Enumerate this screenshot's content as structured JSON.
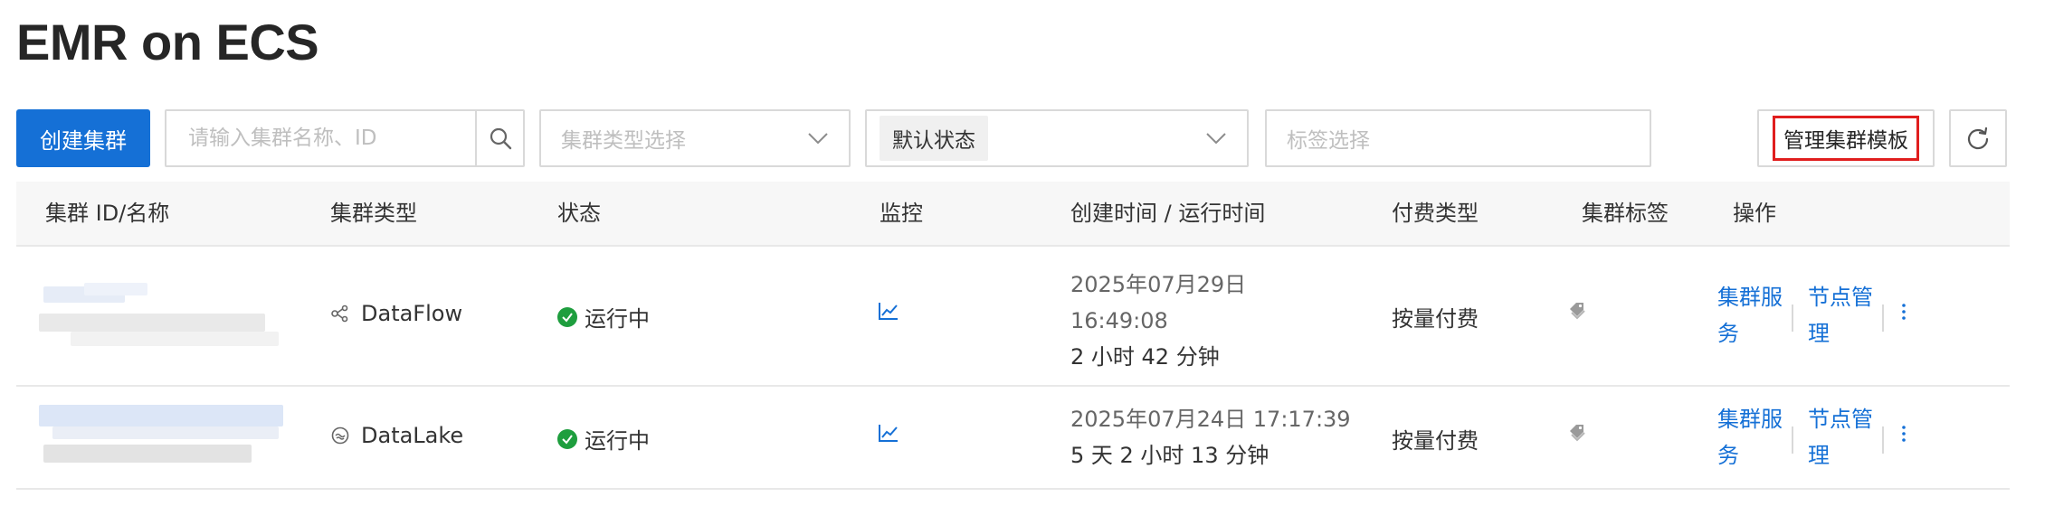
{
  "page": {
    "title": "EMR on ECS"
  },
  "toolbar": {
    "create_label": "创建集群",
    "search_placeholder": "请输入集群名称、ID",
    "type_select_placeholder": "集群类型选择",
    "status_select_value": "默认状态",
    "tag_select_placeholder": "标签选择",
    "manage_template_label": "管理集群模板"
  },
  "table": {
    "columns": [
      "集群 ID/名称",
      "集群类型",
      "状态",
      "监控",
      "创建时间 / 运行时间",
      "付费类型",
      "集群标签",
      "操作"
    ],
    "rows": [
      {
        "type": "DataFlow",
        "status": "运行中",
        "created_line1": "2025年07月29日",
        "created_line2": "16:49:08",
        "runtime": "2 小时 42 分钟",
        "billing": "按量付费",
        "action1_line1": "集群服",
        "action1_line2": "务",
        "action2_line1": "节点管",
        "action2_line2": "理"
      },
      {
        "type": "DataLake",
        "status": "运行中",
        "created_line1": "2025年07月24日 17:17:39",
        "runtime": "5 天 2 小时 13 分钟",
        "billing": "按量付费",
        "action1_line1": "集群服",
        "action1_line2": "务",
        "action2_line1": "节点管",
        "action2_line2": "理"
      }
    ]
  },
  "colors": {
    "primary": "#1570d6",
    "success": "#1e9e3e",
    "highlight_border": "#e01e1e"
  },
  "icons": [
    "search-icon",
    "chevron-down-icon",
    "refresh-icon",
    "success-check-icon",
    "dataflow-icon",
    "datalake-icon",
    "chart-icon",
    "tag-icon",
    "more-vertical-icon"
  ]
}
